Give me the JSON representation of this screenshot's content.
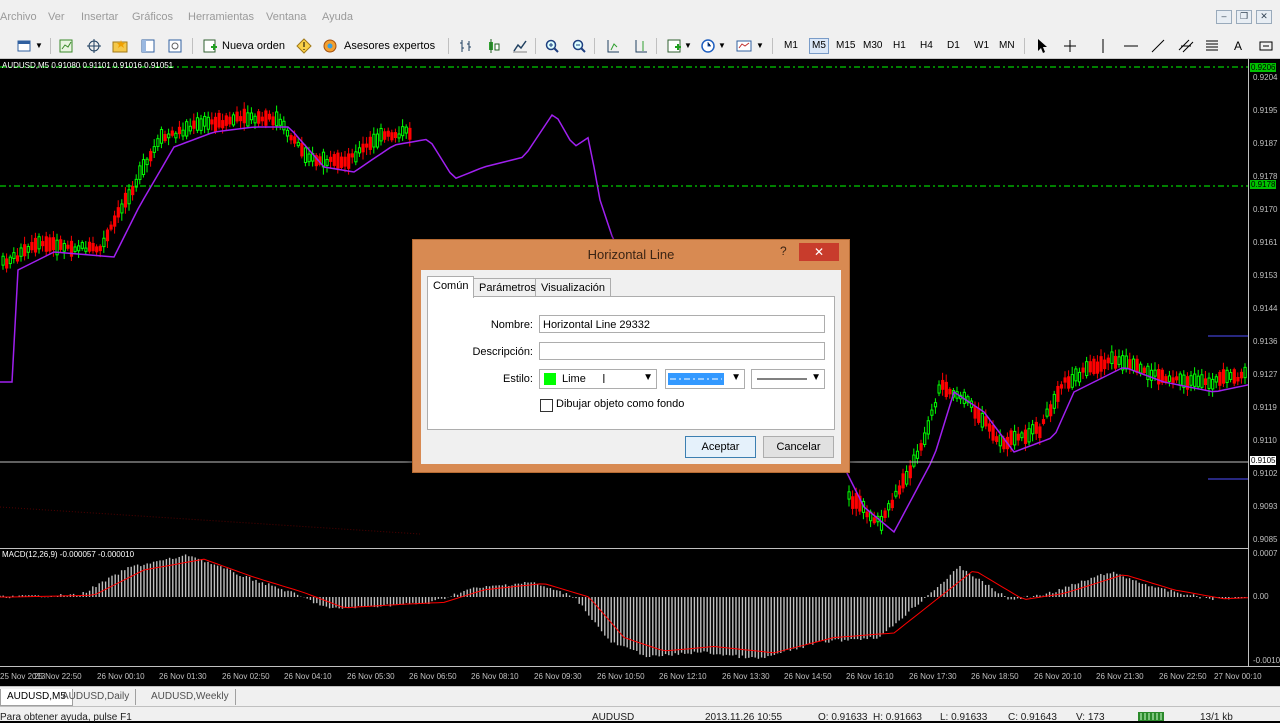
{
  "menu": [
    "Archivo",
    "Ver",
    "Insertar",
    "Gráficos",
    "Herramientas",
    "Ventana",
    "Ayuda"
  ],
  "toolbar": {
    "new_order": "Nueva orden",
    "expert_advisors": "Asesores expertos",
    "timeframes": [
      "M1",
      "M5",
      "M15",
      "M30",
      "H1",
      "H4",
      "D1",
      "W1",
      "MN"
    ],
    "active_timeframe": "M5",
    "text_tool": "A"
  },
  "chart": {
    "info": "AUDUSD,M5  0.91080 0.91101 0.91016 0.91051",
    "price_labels": [
      "0.9204",
      "0.9195",
      "0.9187",
      "0.9178",
      "0.9170",
      "0.9161",
      "0.9153",
      "0.9144",
      "0.9136",
      "0.9127",
      "0.9119",
      "0.9110",
      "0.9102",
      "0.9093",
      "0.9085"
    ],
    "marker_top": "0.9206",
    "marker_green": "0.9178",
    "marker_white": "0.9105"
  },
  "macd": {
    "info": "MACD(12,26,9) -0.000057 -0.000010",
    "axis_labels": [
      "0.0007",
      "0.00",
      "-0.0010"
    ]
  },
  "time_labels": [
    "25 Nov 2013",
    "25 Nov 22:50",
    "26 Nov 00:10",
    "26 Nov 01:30",
    "26 Nov 02:50",
    "26 Nov 04:10",
    "26 Nov 05:30",
    "26 Nov 06:50",
    "26 Nov 08:10",
    "26 Nov 09:30",
    "26 Nov 10:50",
    "26 Nov 12:10",
    "26 Nov 13:30",
    "26 Nov 14:50",
    "26 Nov 16:10",
    "26 Nov 17:30",
    "26 Nov 18:50",
    "26 Nov 20:10",
    "26 Nov 21:30",
    "26 Nov 22:50",
    "27 Nov 00:10"
  ],
  "chart_tabs": [
    "AUDUSD,M5",
    "AUDUSD,Daily",
    "AUDUSD,Weekly"
  ],
  "status": {
    "help": "Para obtener ayuda, pulse F1",
    "symbol": "AUDUSD",
    "datetime": "2013.11.26 10:55",
    "open": "O: 0.91633",
    "high": "H: 0.91663",
    "low": "L: 0.91633",
    "close": "C: 0.91643",
    "volume": "V: 173",
    "traffic": "13/1 kb"
  },
  "dialog": {
    "title": "Horizontal Line",
    "help": "?",
    "close": "✕",
    "tabs": [
      "Común",
      "Parámetros",
      "Visualización"
    ],
    "active_tab": "Común",
    "name_label": "Nombre:",
    "name_value": "Horizontal Line 29332",
    "desc_label": "Descripción:",
    "desc_value": "",
    "style_label": "Estilo:",
    "color_name": "Lime",
    "color_hex": "#00ff00",
    "background_label": "Dibujar objeto como fondo",
    "background_checked": false,
    "ok": "Aceptar",
    "cancel": "Cancelar"
  },
  "colors": {
    "candle_up": "#00ff00",
    "candle_down": "#ff0000",
    "moving_average": "#a020f0",
    "macd_hist": "#c0c0c0",
    "macd_signal": "#ff0000",
    "hline": "#00ff00"
  }
}
